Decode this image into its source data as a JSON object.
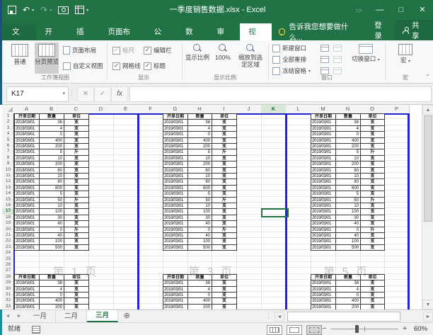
{
  "title_bar": {
    "title": "一季度销售数据.xlsx - Excel",
    "qat": {
      "save": "save",
      "undo": "↶",
      "redo": "↷",
      "customize": "▾"
    },
    "window": {
      "minimize": "—",
      "maximize": "□",
      "close": "✕"
    }
  },
  "ribbon": {
    "tabs": [
      "文件",
      "开始",
      "插入",
      "页面布局",
      "公式",
      "数据",
      "审阅",
      "视图"
    ],
    "active_tab": "视图",
    "tell_me": "告诉我您想要做什么...",
    "sign_in": "登录",
    "share": "共享",
    "view_group": {
      "title": "工作簿视图",
      "normal": "普通",
      "page_break": "分页预览",
      "page_layout": "页面布局",
      "custom_views": "自定义视图"
    },
    "show_group": {
      "title": "显示",
      "ruler": "标尺",
      "formula_bar": "编辑栏",
      "gridlines": "网格线",
      "headings": "标题",
      "check": "✓"
    },
    "zoom_group": {
      "title": "显示比例",
      "zoom": "显示比例",
      "pct100": "100%",
      "zoom_selection": "缩放到选定区域"
    },
    "window_group": {
      "title": "窗口",
      "new_window": "新建窗口",
      "arrange_all": "全部重排",
      "freeze_panes": "冻结窗格",
      "switch_windows": "切换窗口"
    },
    "macro_group": {
      "title": "宏",
      "macros": "宏"
    }
  },
  "formula_bar": {
    "name_box": "K17",
    "fx_label": "fx",
    "cancel": "✕",
    "enter": "✓",
    "formula": ""
  },
  "grid": {
    "columns": [
      "A",
      "B",
      "C",
      "D",
      "E",
      "F",
      "G",
      "H",
      "I",
      "J",
      "K",
      "L",
      "M",
      "N",
      "O",
      "P"
    ],
    "visible_rows": 33,
    "selected_cell": "K17",
    "selected_column": "K",
    "selected_row": 17,
    "watermarks": [
      "第 1 页",
      "第 3 页",
      "第 5 页"
    ],
    "table": {
      "headers": [
        "开单日期",
        "数量",
        "单位"
      ],
      "date": "2019/03/01",
      "top_quantities": [
        38,
        4,
        0,
        400,
        200,
        5,
        10,
        200,
        60,
        10,
        80,
        600,
        5,
        50,
        10,
        100,
        30,
        40,
        0,
        40,
        100,
        500
      ],
      "top_units": [
        "支",
        "支",
        "支",
        "支",
        "支",
        "斤",
        "支",
        "支",
        "支",
        "支",
        "支",
        "支",
        "支",
        "斤",
        "支",
        "支",
        "支",
        "支",
        "斤",
        "支",
        "支",
        "支"
      ],
      "bottom_quantities": [
        38,
        4,
        0,
        400,
        200
      ],
      "bottom_units": [
        "支",
        "支",
        "支",
        "支",
        "支"
      ]
    }
  },
  "sheet_tabs": {
    "tabs": [
      "一月",
      "二月",
      "三月"
    ],
    "active": "三月",
    "add_label": "⊕"
  },
  "status_bar": {
    "ready": "就绪",
    "zoom_level": "60%"
  },
  "colors": {
    "accent_green": "#217346",
    "page_break_blue": "#2323cd",
    "selection_green": "#217346"
  }
}
